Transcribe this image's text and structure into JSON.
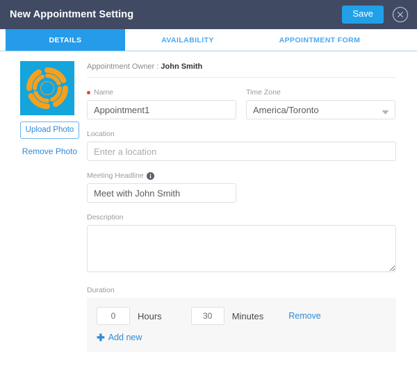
{
  "titlebar": {
    "title": "New Appointment Setting",
    "save_label": "Save",
    "close_icon": "close-circle-icon"
  },
  "tabs": [
    {
      "label": "DETAILS",
      "active": true
    },
    {
      "label": "AVAILABILITY",
      "active": false
    },
    {
      "label": "APPOINTMENT FORM",
      "active": false
    }
  ],
  "photo": {
    "logo_icon": "orange-ring-logo",
    "upload_label": "Upload Photo",
    "remove_label": "Remove Photo"
  },
  "form": {
    "owner_prefix": "Appointment Owner : ",
    "owner_name": "John Smith",
    "name": {
      "label": "Name",
      "value": "Appointment1",
      "required": true
    },
    "timezone": {
      "label": "Time Zone",
      "value": "America/Toronto",
      "chevron_icon": "chevron-down-icon"
    },
    "location": {
      "label": "Location",
      "value": "",
      "placeholder": "Enter a location"
    },
    "headline": {
      "label": "Meeting Headline",
      "info_icon": "info-icon",
      "value": "Meet with John Smith",
      "placeholder": ""
    },
    "description": {
      "label": "Description",
      "value": "",
      "placeholder": ""
    },
    "duration": {
      "label": "Duration",
      "hours_value": "0",
      "hours_label": "Hours",
      "minutes_value": "30",
      "minutes_label": "Minutes",
      "remove_label": "Remove",
      "add_new_label": "Add new",
      "plus_icon": "plus-icon"
    }
  },
  "colors": {
    "header_bg": "#404a63",
    "accent_blue": "#21a0e8",
    "tab_active_bg": "#269bea",
    "link_blue": "#2e8ad6",
    "required_red": "#e2453c",
    "logo_orange": "#f5a01e",
    "logo_bg": "#14a5dd",
    "panel_gray": "#f7f7f7"
  }
}
